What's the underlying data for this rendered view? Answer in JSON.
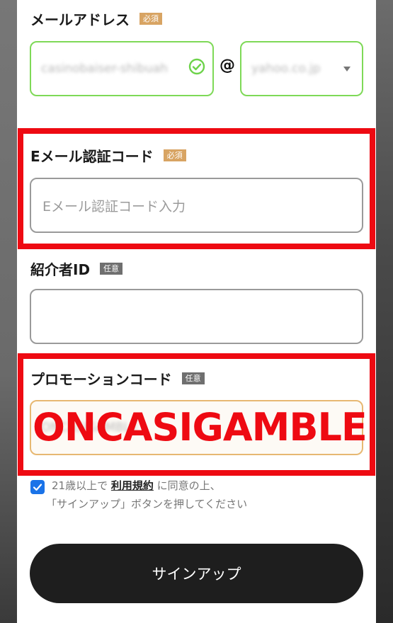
{
  "email": {
    "label": "メールアドレス",
    "badge": "必須",
    "local_value": "casinobaiser-shibuah",
    "at_symbol": "@",
    "domain_value": "yahoo.co.jp"
  },
  "verification": {
    "label": "Eメール認証コード",
    "badge": "必須",
    "placeholder": "Eメール認証コード入力"
  },
  "referrer": {
    "label": "紹介者ID",
    "badge": "任意"
  },
  "promo": {
    "label": "プロモーションコード",
    "badge": "任意",
    "value": "ONCASIGAMBLE",
    "overlay_text": "ONCASIGAMBLE"
  },
  "consent": {
    "checked": true,
    "prefix": "21歳以上で",
    "terms_link": "利用規約",
    "suffix": "に同意の上、",
    "line2": "「サインアップ」ボタンを押してください"
  },
  "signup_button": "サインアップ",
  "colors": {
    "accent_red": "#ee0a12",
    "valid_green": "#7ed957",
    "required_badge": "#d8a463",
    "optional_badge": "#6f6f6f",
    "button_dark": "#1e1e1e",
    "checkbox_blue": "#1a73e8"
  }
}
